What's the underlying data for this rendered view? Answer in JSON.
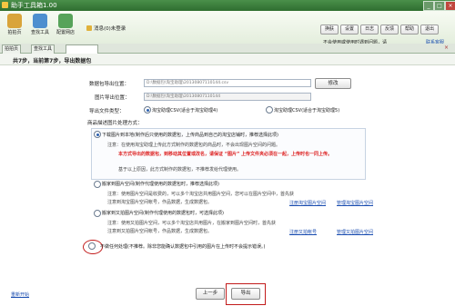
{
  "app": {
    "title": "助手工具箱1.00"
  },
  "titlebar": {
    "min": "_",
    "max": "□",
    "close": "×"
  },
  "toolbar": {
    "items": [
      {
        "label": "拍拍页",
        "color": "#d9a43b"
      },
      {
        "label": "查找工具",
        "color": "#4e8fcf"
      },
      {
        "label": "配置网店",
        "color": "#57a35a"
      }
    ],
    "status_text": "消息(0)未登录",
    "right_buttons": [
      "换肤",
      "设置",
      "日志",
      "反馈",
      "帮助",
      "退出"
    ],
    "notice_text": "不会使用或使用时遇到问题，请",
    "notice_link": "联系客服"
  },
  "tabs": [
    {
      "label": "拍拍页"
    },
    {
      "label": "查找工具"
    },
    {
      "label": ""
    }
  ],
  "step": {
    "text": "共7步，当前第7步，导出数据包"
  },
  "form": {
    "pkg_label": "数据包导出位置：",
    "pkg_value": "D:\\数据包\\淘宝助理\\20130807110144.csv",
    "modify_label": "修改",
    "img_label": "图片导出位置：",
    "img_value": "D:\\数据包\\淘宝助理\\20130807110144",
    "filetype_label": "导出文件类型：",
    "filetype_opt1": "淘宝助理CSV(适合于淘宝助理4)",
    "filetype_opt2": "淘宝助理CSV(适合于淘宝助理5)",
    "desc_label": "商品描述图片处理方式："
  },
  "opt1": {
    "title": "下载图片到本地(制作后只使用的数据包，上传商品到自己的淘宝店铺时，推荐选择此项)",
    "line1": "注意：在使用淘宝助理上传此方式制作的数据包的商品时，不会出现图片空间的问题。",
    "line2": "本方式导出的数据包，到移动其位置或改名，请保证 “图片” 上传文件夹必须在一起，上传时也一同上传。",
    "line3": "基于以上原因，此方式制作的数据包，不推荐发给代理使用。"
  },
  "opt2": {
    "title": "搬家到图片空间(制作代理使用的数据包时，推荐选择此项)",
    "line1": "注意：使用图片空间是收费的，可以多个淘宝店共用图片空间，您可以在图片空间中，首先获",
    "line2": "注意到淘宝图片空间帐号，作品数据，生成数据包。",
    "link1": "注册淘宝图片空间",
    "link2": "管理淘宝图片空间"
  },
  "opt3": {
    "title": "搬家到又拍图片空间(制作代理使用的数据包时，可选择此项)",
    "line1": "注意：使用又拍图片空间，可以多个淘宝店共用图片，在搬家到图片空间时，首先获",
    "line2": "注意到又拍图片空间帐号，作品数据，生成数据包。",
    "link1": "注册又拍帐号",
    "link2": "管理又拍图片空间"
  },
  "opt4": {
    "title": "不做任何处理(不推荐。除非您能确认数据包中引用的图片在上传时不会提示错误。)"
  },
  "bottom": {
    "restart": "重新开始",
    "prev": "上一步",
    "export": "导出"
  }
}
